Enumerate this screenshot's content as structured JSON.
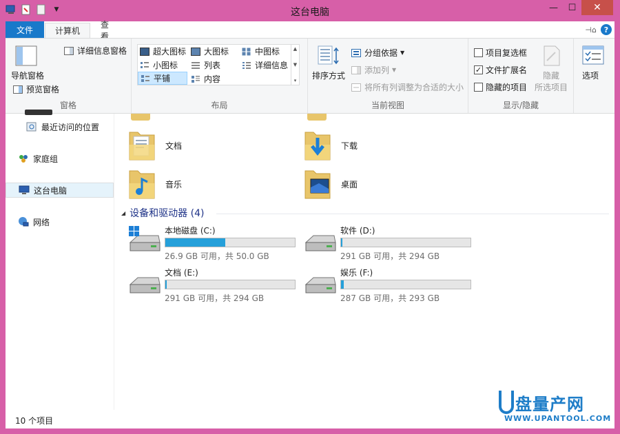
{
  "window": {
    "title": "这台电脑"
  },
  "title_buttons": {
    "minimize": "—",
    "maximize": "☐",
    "close": "✕"
  },
  "tabs": {
    "file": "文件",
    "computer": "计算机",
    "view": "查看"
  },
  "ribbon": {
    "pane": {
      "label": "窗格",
      "nav_pane": "导航窗格",
      "preview_pane": "预览窗格",
      "details_pane": "详细信息窗格"
    },
    "layout": {
      "label": "布局",
      "items": [
        "超大图标",
        "大图标",
        "中图标",
        "小图标",
        "列表",
        "详细信息",
        "平铺",
        "内容"
      ],
      "selected": "平铺"
    },
    "current_view": {
      "label": "当前视图",
      "sort_by": "排序方式",
      "group_by": "分组依据",
      "add_column": "添加列",
      "fit_columns": "将所有列调整为合适的大小"
    },
    "show_hide": {
      "label": "显示/隐藏",
      "item_checkboxes": {
        "label": "项目复选框",
        "checked": false
      },
      "file_extensions": {
        "label": "文件扩展名",
        "checked": true
      },
      "hidden_items": {
        "label": "隐藏的项目",
        "checked": false
      },
      "hide_selected_line1": "隐藏",
      "hide_selected_line2": "所选项目"
    },
    "options": "选项"
  },
  "nav": {
    "items": [
      {
        "label": "最近访问的位置",
        "icon": "recent-places-icon"
      },
      {
        "label": "家庭组",
        "icon": "homegroup-icon"
      },
      {
        "label": "这台电脑",
        "icon": "computer-icon"
      },
      {
        "label": "网络",
        "icon": "network-icon"
      }
    ]
  },
  "folders": [
    {
      "name": "文档",
      "icon": "documents-folder-icon"
    },
    {
      "name": "下载",
      "icon": "downloads-folder-icon"
    },
    {
      "name": "音乐",
      "icon": "music-folder-icon"
    },
    {
      "name": "桌面",
      "icon": "desktop-folder-icon"
    }
  ],
  "drives_section": {
    "title": "设备和驱动器 (4)"
  },
  "drives": [
    {
      "name": "本地磁盘 (C:)",
      "info": "26.9 GB 可用，共 50.0 GB",
      "used_fraction": 0.462
    },
    {
      "name": "软件 (D:)",
      "info": "291 GB 可用，共 294 GB",
      "used_fraction": 0.01
    },
    {
      "name": "文档 (E:)",
      "info": "291 GB 可用，共 294 GB",
      "used_fraction": 0.01
    },
    {
      "name": "娱乐 (F:)",
      "info": "287 GB 可用，共 293 GB",
      "used_fraction": 0.02
    }
  ],
  "status": {
    "item_count": "10 个项目"
  },
  "watermark": {
    "main": "盘量产网",
    "sub": "WWW.UPANTOOL.COM"
  },
  "colors": {
    "accent": "#1979ca",
    "window_frame": "#d75fa8",
    "drive_bar": "#26a0da",
    "section_title": "#1e3287"
  }
}
